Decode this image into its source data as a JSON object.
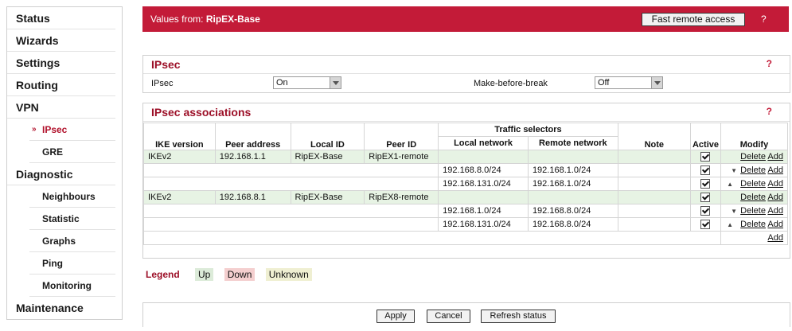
{
  "nav": {
    "status": "Status",
    "wizards": "Wizards",
    "settings": "Settings",
    "routing": "Routing",
    "vpn": "VPN",
    "ipsec": "IPsec",
    "gre": "GRE",
    "diagnostic": "Diagnostic",
    "neighbours": "Neighbours",
    "statistic": "Statistic",
    "graphs": "Graphs",
    "ping": "Ping",
    "monitoring": "Monitoring",
    "maintenance": "Maintenance"
  },
  "header": {
    "values_from_label": "Values from:",
    "device": "RipEX-Base",
    "fast_remote_access": "Fast remote access",
    "help": "?"
  },
  "ipsec_panel": {
    "title": "IPsec",
    "help": "?",
    "ipsec_label": "IPsec",
    "ipsec_value": "On",
    "mbb_label": "Make-before-break",
    "mbb_value": "Off"
  },
  "assoc_panel": {
    "title": "IPsec associations",
    "help": "?",
    "headers": {
      "ike": "IKE version",
      "peer_address": "Peer address",
      "local_id": "Local ID",
      "peer_id": "Peer ID",
      "traffic_selectors": "Traffic selectors",
      "local_network": "Local network",
      "remote_network": "Remote network",
      "note": "Note",
      "active": "Active",
      "modify": "Modify"
    },
    "peers": [
      {
        "ike": "IKEv2",
        "peer_address": "192.168.1.1",
        "local_id": "RipEX-Base",
        "peer_id": "RipEX1-remote",
        "selectors": [
          {
            "local": "192.168.8.0/24",
            "remote": "192.168.1.0/24"
          },
          {
            "local": "192.168.131.0/24",
            "remote": "192.168.1.0/24"
          }
        ]
      },
      {
        "ike": "IKEv2",
        "peer_address": "192.168.8.1",
        "local_id": "RipEX-Base",
        "peer_id": "RipEX8-remote",
        "selectors": [
          {
            "local": "192.168.1.0/24",
            "remote": "192.168.8.0/24"
          },
          {
            "local": "192.168.131.0/24",
            "remote": "192.168.8.0/24"
          }
        ]
      }
    ],
    "delete": "Delete",
    "add": "Add"
  },
  "legend": {
    "title": "Legend",
    "up": "Up",
    "down": "Down",
    "unknown": "Unknown"
  },
  "colors": {
    "accent": "#c31b38",
    "title": "#9c0f27",
    "up": "#dcebd9",
    "down": "#f4cfcf",
    "unknown": "#efefd2"
  },
  "buttons": {
    "apply": "Apply",
    "cancel": "Cancel",
    "refresh": "Refresh status"
  }
}
